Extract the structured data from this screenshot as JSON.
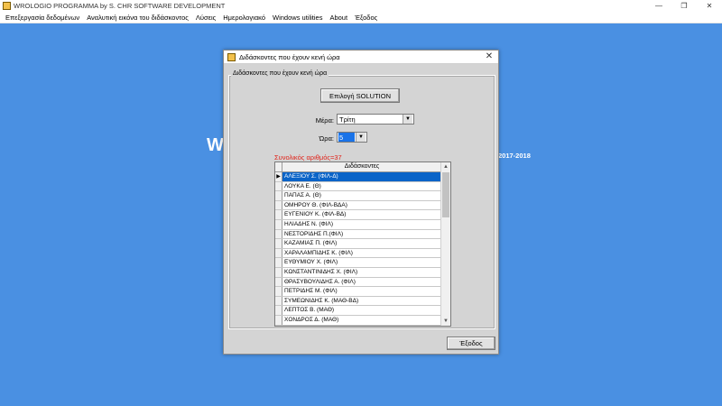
{
  "app": {
    "title": "WROLOGIO PROGRAMMA by S. CHR SOFTWARE DEVELOPMENT",
    "minimize": "—",
    "maximize": "❐",
    "close": "✕"
  },
  "menu": {
    "items": [
      "Επεξεργασία δεδομένων",
      "Αναλυτική εικόνα του διδάσκοντος",
      "Λύσεις",
      "Ημερολογιακό",
      "Windows utilities",
      "About",
      "Έξοδος"
    ]
  },
  "background": {
    "letter": "W",
    "year_text": "2017-2018"
  },
  "dialog": {
    "title": "Διδάσκοντες που έχουν κενή ώρα",
    "close": "✕",
    "group_label": "Διδάσκοντες που έχουν κενή ώρα",
    "solution_button": "Επιλογή SOLUTION",
    "day_label": "Μέρα:",
    "day_value": "Τρίτη",
    "hour_label": "Ώρα:",
    "hour_value": "5",
    "count_text": "Συνολικός αριθμός=37",
    "grid_header": "Διδάσκοντες",
    "rows": [
      "ΑΛΕΞΙΟΥ Σ. (ΦΙΛ-Δ)",
      "ΛΟΥΚΑ Ε. (Θ)",
      "ΠΑΠΑΣ Α. (Θ)",
      "ΟΜΗΡΟΥ Θ. (ΦΙΛ-ΒΔΑ)",
      "ΕΥΓΕΝΙΟΥ Κ. (ΦΙΛ-ΒΔ)",
      "ΗΛΙΑΔΗΣ Ν. (ΦΙΛ)",
      "ΝΕΣΤΟΡΙΔΗΣ Π.(ΦΙΛ)",
      "ΚΑΖΑΜΙΑΣ Π. (ΦΙΛ)",
      "ΧΑΡΑΛΑΜΠΙΔΗΣ Κ. (ΦΙΛ)",
      "ΕΥΘΥΜΙΟΥ Χ. (ΦΙΛ)",
      "ΚΩΝΣΤΑΝΤΙΝΙΔΗΣ Χ. (ΦΙΛ)",
      "ΘΡΑΣΥΒΟΥΛΙΔΗΣ Α. (ΦΙΛ)",
      "ΠΕΤΡΙΔΗΣ Μ. (ΦΙΛ)",
      "ΣΥΜΕΩΝΙΔΗΣ Κ. (ΜΑΘ-ΒΔ)",
      "ΛΕΠΤΟΣ Β. (ΜΑΘ)",
      "ΧΟΝΔΡΟΣ Δ. (ΜΑΘ)"
    ],
    "selected_row_marker": "▶",
    "exit_button": "Έξοδος"
  },
  "colors": {
    "desktop": "#4a90e2",
    "selection": "#0a64c8",
    "count_red": "#e0241b"
  }
}
